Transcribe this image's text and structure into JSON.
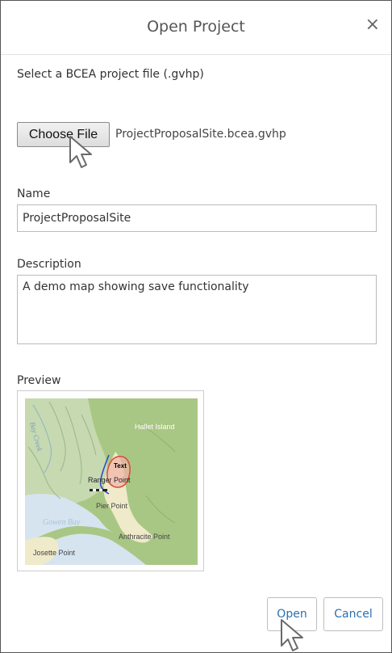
{
  "dialog": {
    "title": "Open Project",
    "close_icon": "close-icon",
    "close_glyph": "×"
  },
  "instruction": "Select a BCEA project file (.gvhp)",
  "file_picker": {
    "button_label": "Choose File",
    "file_name": "ProjectProposalSite.bcea.gvhp"
  },
  "name_field": {
    "label": "Name",
    "value": "ProjectProposalSite"
  },
  "description_field": {
    "label": "Description",
    "value": "A demo map showing save functionality"
  },
  "preview": {
    "label": "Preview",
    "map_labels": {
      "hallet_island": "Hallet Island",
      "text_marker": "Text",
      "ranger_point": "Ranger Point",
      "pier_point": "Pier Point",
      "gowen_bay": "Gowen Bay",
      "anthracite_point": "Anthracite Point",
      "josette_point": "Josette Point",
      "bay_creek": "Bay Creek"
    },
    "colors": {
      "water": "#d6e4f0",
      "land": "#a9c784",
      "polygon_stroke": "#d94a3a",
      "line_stroke": "#2b45c9"
    }
  },
  "actions": {
    "open_label": "Open",
    "cancel_label": "Cancel"
  },
  "cursor_icon": "mouse-pointer-icon"
}
